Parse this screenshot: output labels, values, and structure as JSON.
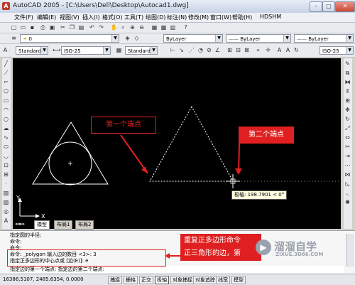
{
  "window": {
    "title": "AutoCAD 2005 - [C:\\Users\\Dell\\Desktop\\Autocad1.dwg]",
    "app_icon_text": "A"
  },
  "menu": [
    "文件(F)",
    "编辑(E)",
    "视图(V)",
    "插入(I)",
    "格式(O)",
    "工具(T)",
    "绘图(D)",
    "标注(N)",
    "修改(M)",
    "窗口(W)",
    "帮助(H)",
    "HDSHM"
  ],
  "toolbars": {
    "layer_value": "0",
    "color_value": "ByLayer",
    "linetype_value": "ByLayer",
    "lineweight_value": "ByLayer",
    "text_style": "Standard",
    "dim_style": "ISO-25",
    "table_style": "Standard",
    "dim_style_right": "ISO-25"
  },
  "canvas": {
    "tooltip": "极轴: 198.7901 < 0°",
    "callout_first": "第一个端点",
    "callout_second": "第二个端点",
    "ucs_x": "X",
    "ucs_y": "Y"
  },
  "tabs": [
    "模型",
    "布局1",
    "布局2"
  ],
  "command_lines": [
    "指定圆的半径:",
    "命令:",
    "命令:",
    "命令: _polygon 输入边的数目 <3>: 3",
    "指定正多边形的中心点或 [边(E)]: e",
    "指定边的第一个端点: 指定边的第二个端点:"
  ],
  "command_callout": {
    "line1": "重复正多边形命令",
    "line2": "正三角形的边，第"
  },
  "watermark": {
    "brand": "溜溜自学",
    "url": "ZIXUE.3D66.COM"
  },
  "status": {
    "coords": "16386.5107, 2485.6354, 0.0000",
    "buttons": [
      "捕捉",
      "栅格",
      "正交",
      "极轴",
      "对象捕捉",
      "对象追踪",
      "线宽",
      "模型"
    ]
  },
  "colors": {
    "canvas_bg": "#000000",
    "callout_red": "#e02020",
    "geometry": "#ffffff"
  }
}
